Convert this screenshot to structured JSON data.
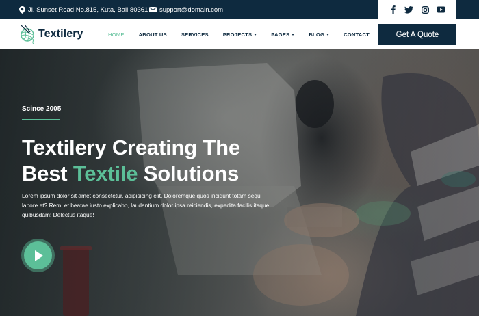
{
  "topbar": {
    "address": "Jl. Sunset Road No.815, Kuta, Bali 80361",
    "email": "support@domain.com",
    "social": [
      "facebook-icon",
      "twitter-icon",
      "instagram-icon",
      "youtube-icon"
    ]
  },
  "brand": {
    "name": "Textilery"
  },
  "nav": {
    "items": [
      {
        "label": "HOME",
        "active": true
      },
      {
        "label": "ABOUT US"
      },
      {
        "label": "SERVICES"
      },
      {
        "label": "PROJECTS",
        "dropdown": true
      },
      {
        "label": "PAGES",
        "dropdown": true
      },
      {
        "label": "BLOG",
        "dropdown": true
      },
      {
        "label": "CONTACT"
      }
    ],
    "cta": "Get A Quote"
  },
  "hero": {
    "since": "Scince 2005",
    "headline_line1": "Textilery Creating The",
    "headline_best": "Best",
    "headline_accent": "Textile",
    "headline_end": "Solutions",
    "description": "Lorem ipsum dolor sit amet consectetur, adipisicing elit. Doloremque quos incidunt totam sequi labore et? Rem, et beatae iusto explicabo, laudantium dolor ipsa reiciendis, expedita facilis itaque quibusdam! Delectus itaque!"
  },
  "colors": {
    "navy": "#0e2a3f",
    "accent": "#5cbf98"
  }
}
